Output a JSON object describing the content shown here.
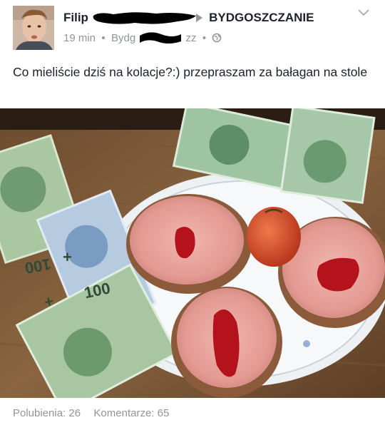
{
  "post": {
    "author_name_visible": "Filip",
    "group_name": "BYDGOSZCZANIE",
    "time": "19 min",
    "location_visible": "Bydg",
    "location_suffix_visible": "zz",
    "privacy_icon": "globe-icon",
    "menu_icon": "chevron-down-icon",
    "text": "Co mieliście dziś na kolacje?:) przepraszam za bałagan na stole"
  },
  "stats": {
    "likes": "Polubienia: 26",
    "comments": "Komentarze: 65"
  },
  "photo": {
    "banknote_label": "100",
    "banknote_corner": "+"
  },
  "colors": {
    "text_primary": "#1d2129",
    "text_secondary": "#90949c"
  }
}
